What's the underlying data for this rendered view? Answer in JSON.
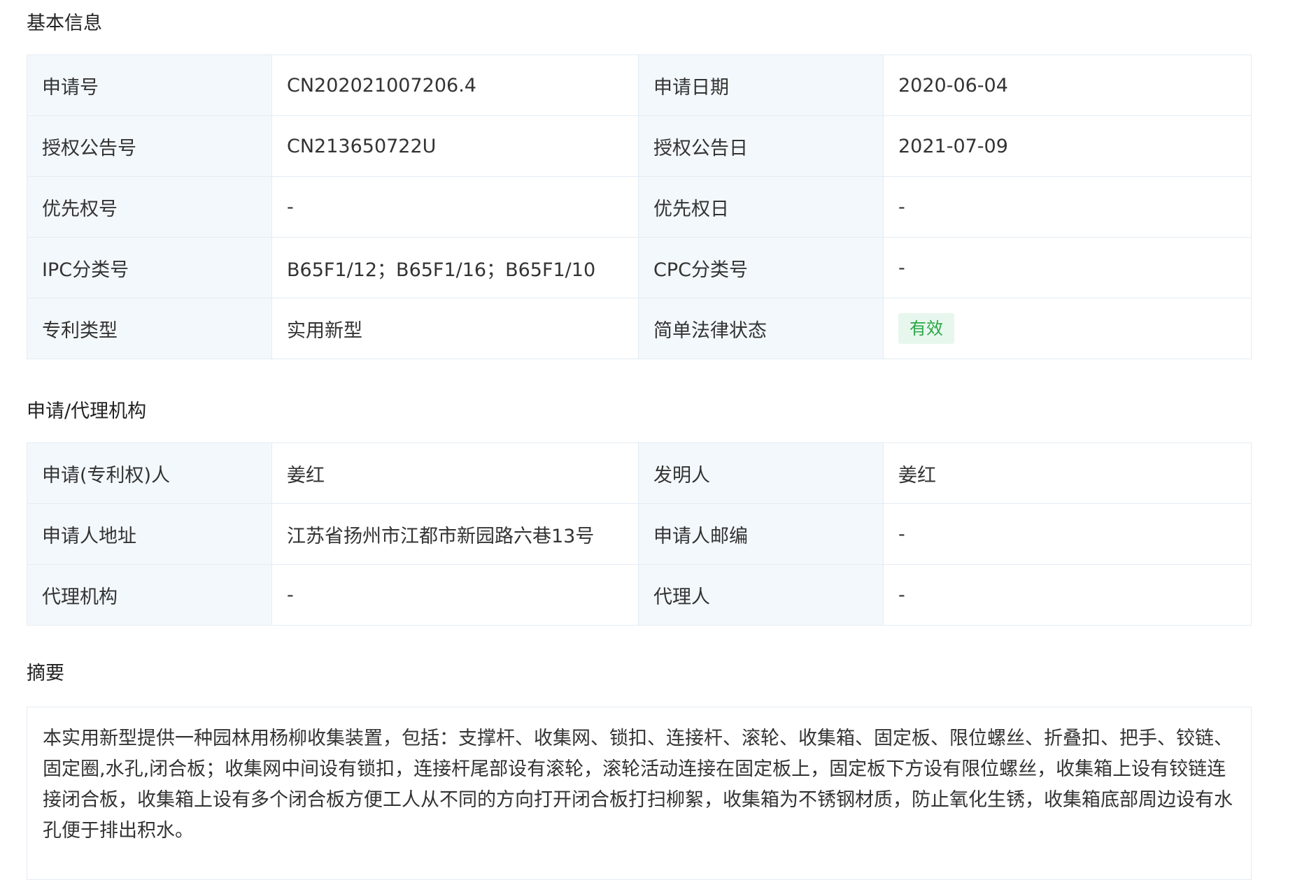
{
  "sections": {
    "basic_info": "基本信息",
    "agency": "申请/代理机构",
    "abstract": "摘要"
  },
  "basic_info": {
    "rows": [
      {
        "label1": "申请号",
        "value1": "CN202021007206.4",
        "label2": "申请日期",
        "value2": "2020-06-04"
      },
      {
        "label1": "授权公告号",
        "value1": "CN213650722U",
        "label2": "授权公告日",
        "value2": "2021-07-09"
      },
      {
        "label1": "优先权号",
        "value1": "-",
        "label2": "优先权日",
        "value2": "-"
      },
      {
        "label1": "IPC分类号",
        "value1": "B65F1/12；B65F1/16；B65F1/10",
        "label2": "CPC分类号",
        "value2": "-"
      },
      {
        "label1": "专利类型",
        "value1": "实用新型",
        "label2": "简单法律状态",
        "value2": "有效"
      }
    ],
    "status_color": "#28a745"
  },
  "agency": {
    "rows": [
      {
        "label1": "申请(专利权)人",
        "value1": "姜红",
        "label2": "发明人",
        "value2": "姜红"
      },
      {
        "label1": "申请人地址",
        "value1": "江苏省扬州市江都市新园路六巷13号",
        "label2": "申请人邮编",
        "value2": "-"
      },
      {
        "label1": "代理机构",
        "value1": "-",
        "label2": "代理人",
        "value2": "-"
      }
    ]
  },
  "abstract": {
    "text": "本实用新型提供一种园林用杨柳收集装置，包括：支撑杆、收集网、锁扣、连接杆、滚轮、收集箱、固定板、限位螺丝、折叠扣、把手、铰链、固定圈,水孔,闭合板；收集网中间设有锁扣，连接杆尾部设有滚轮，滚轮活动连接在固定板上，固定板下方设有限位螺丝，收集箱上设有铰链连接闭合板，收集箱上设有多个闭合板方便工人从不同的方向打开闭合板打扫柳絮，收集箱为不锈钢材质，防止氧化生锈，收集箱底部周边设有水孔便于排出积水。"
  }
}
